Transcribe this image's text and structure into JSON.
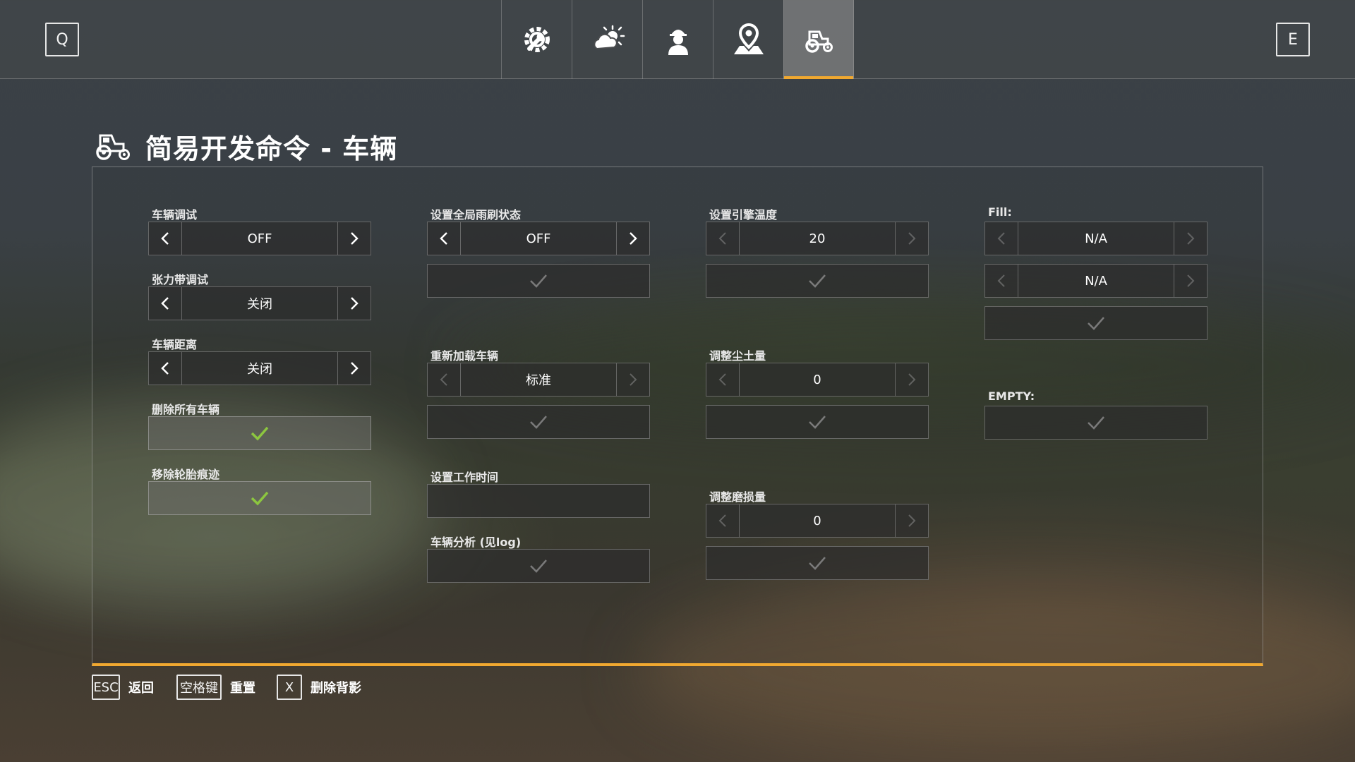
{
  "header": {
    "left_key": "Q",
    "right_key": "E",
    "tabs": [
      {
        "icon": "wrench-gear-icon",
        "active": false
      },
      {
        "icon": "weather-sun-cloud-icon",
        "active": false
      },
      {
        "icon": "farmer-icon",
        "active": false
      },
      {
        "icon": "map-pin-icon",
        "active": false
      },
      {
        "icon": "tractor-icon",
        "active": true
      }
    ]
  },
  "page": {
    "title": "简易开发命令 - 车辆",
    "icon": "tractor-icon"
  },
  "col1": {
    "vehicle_debug": {
      "label": "车辆调试",
      "value": "OFF"
    },
    "tension_debug": {
      "label": "张力带调试",
      "value": "关闭"
    },
    "vehicle_distance": {
      "label": "车辆距离",
      "value": "关闭"
    },
    "delete_all": {
      "label": "删除所有车辆"
    },
    "remove_tracks": {
      "label": "移除轮胎痕迹"
    }
  },
  "col2": {
    "wiper": {
      "label": "设置全局雨刷状态",
      "value": "OFF"
    },
    "reload": {
      "label": "重新加载车辆",
      "value": "标准"
    },
    "work_time": {
      "label": "设置工作时间",
      "value": ""
    },
    "analysis": {
      "label": "车辆分析 (见log)"
    }
  },
  "col3": {
    "engine_temp": {
      "label": "设置引擎温度",
      "value": "20"
    },
    "dirt": {
      "label": "调整尘土量",
      "value": "0"
    },
    "wear": {
      "label": "调整磨损量",
      "value": "0"
    }
  },
  "col4": {
    "fill": {
      "label": "Fill:",
      "value1": "N/A",
      "value2": "N/A"
    },
    "empty": {
      "label": "EMPTY:"
    }
  },
  "footer": {
    "hints": [
      {
        "key": "ESC",
        "label": "返回"
      },
      {
        "key": "空格键",
        "label": "重置"
      },
      {
        "key": "X",
        "label": "删除背影"
      }
    ]
  },
  "colors": {
    "accent": "#f0a830",
    "check_active": "#8cc63f",
    "check_inactive": "#7a7a7a"
  }
}
